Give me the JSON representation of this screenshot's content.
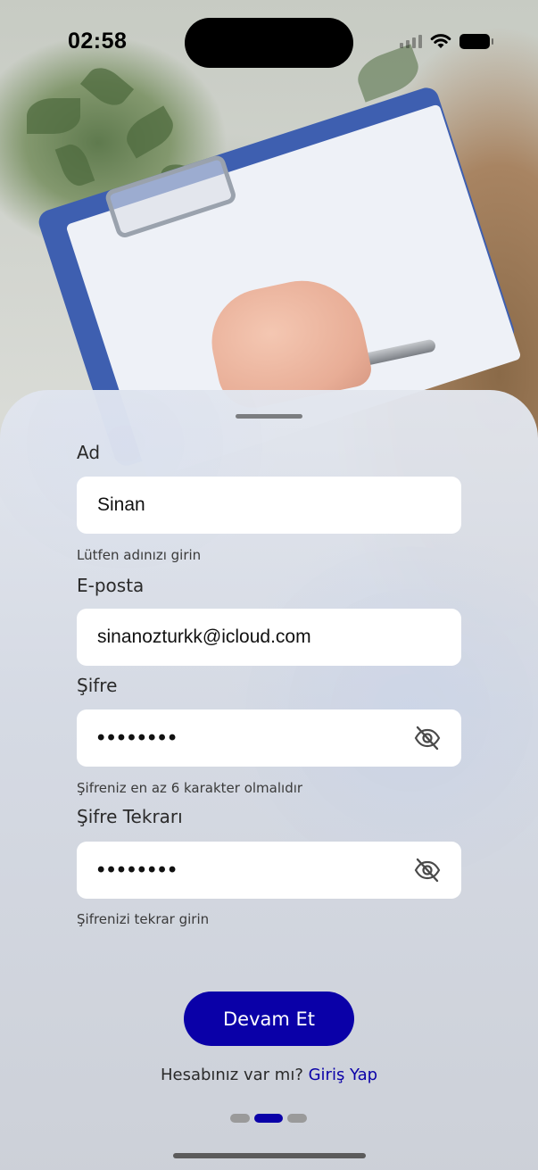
{
  "status_bar": {
    "time": "02:58",
    "icons": [
      "signal-icon",
      "wifi-icon",
      "battery-icon"
    ]
  },
  "form": {
    "name": {
      "label": "Ad",
      "value": "Sinan",
      "helper": "Lütfen adınızı girin"
    },
    "email": {
      "label": "E-posta",
      "value": "sinanozturkk@icloud.com"
    },
    "password": {
      "label": "Şifre",
      "value": "••••••••",
      "helper": "Şifreniz en az 6 karakter olmalıdır",
      "toggle_icon": "eye-off-icon"
    },
    "password_confirm": {
      "label": "Şifre Tekrarı",
      "value": "••••••••",
      "helper": "Şifrenizi tekrar girin",
      "toggle_icon": "eye-off-icon"
    }
  },
  "actions": {
    "continue_label": "Devam Et",
    "login_prompt": "Hesabınız var mı?",
    "login_link": "Giriş Yap"
  },
  "pager": {
    "count": 3,
    "active_index": 1
  },
  "colors": {
    "accent": "#0a00a8",
    "input_background": "#ffffff",
    "pager_inactive": "#9a9a9a"
  }
}
